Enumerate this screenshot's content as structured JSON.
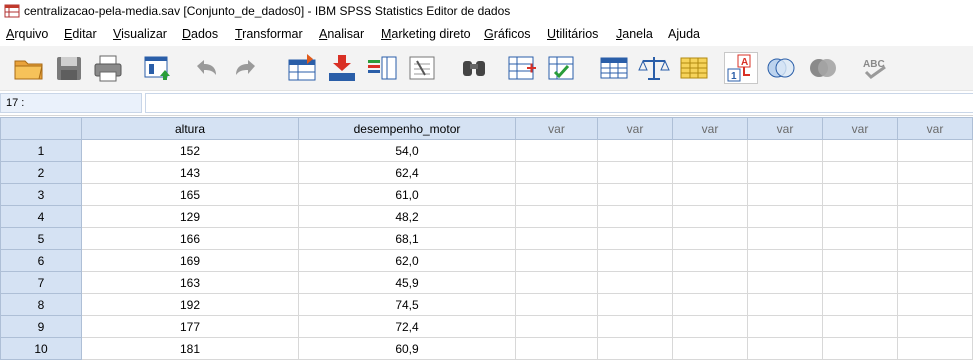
{
  "window": {
    "title": "centralizacao-pela-media.sav [Conjunto_de_dados0] - IBM SPSS Statistics Editor de dados",
    "icon": "spss-data-editor-icon"
  },
  "menu": [
    {
      "label": "Arquivo",
      "accel": "A"
    },
    {
      "label": "Editar",
      "accel": "E"
    },
    {
      "label": "Visualizar",
      "accel": "V"
    },
    {
      "label": "Dados",
      "accel": "D"
    },
    {
      "label": "Transformar",
      "accel": "T"
    },
    {
      "label": "Analisar",
      "accel": "A"
    },
    {
      "label": "Marketing direto",
      "accel": "M"
    },
    {
      "label": "Gráficos",
      "accel": "G"
    },
    {
      "label": "Utilitários",
      "accel": "U"
    },
    {
      "label": "Janela",
      "accel": "J"
    },
    {
      "label": "Ajuda",
      "accel": "u"
    }
  ],
  "toolbar": {
    "icons": [
      "open-folder-icon",
      "save-icon",
      "print-icon",
      "recall-dialog-icon",
      "undo-icon",
      "redo-icon",
      "go-to-case-icon",
      "go-to-variable-icon",
      "variables-icon",
      "run-descriptives-icon",
      "find-icon",
      "insert-cases-icon",
      "insert-variable-icon",
      "split-file-icon",
      "weight-cases-icon",
      "select-cases-icon",
      "value-labels-icon",
      "use-variable-sets-icon",
      "show-all-variables-icon",
      "spell-check-icon"
    ]
  },
  "cell_editor": {
    "reference": "17 :",
    "value": ""
  },
  "grid": {
    "columns": [
      "altura",
      "desempenho_motor",
      "var",
      "var",
      "var",
      "var",
      "var",
      "var"
    ],
    "rows": [
      {
        "n": "1",
        "altura": "152",
        "desempenho_motor": "54,0"
      },
      {
        "n": "2",
        "altura": "143",
        "desempenho_motor": "62,4"
      },
      {
        "n": "3",
        "altura": "165",
        "desempenho_motor": "61,0"
      },
      {
        "n": "4",
        "altura": "129",
        "desempenho_motor": "48,2"
      },
      {
        "n": "5",
        "altura": "166",
        "desempenho_motor": "68,1"
      },
      {
        "n": "6",
        "altura": "169",
        "desempenho_motor": "62,0"
      },
      {
        "n": "7",
        "altura": "163",
        "desempenho_motor": "45,9"
      },
      {
        "n": "8",
        "altura": "192",
        "desempenho_motor": "74,5"
      },
      {
        "n": "9",
        "altura": "177",
        "desempenho_motor": "72,4"
      },
      {
        "n": "10",
        "altura": "181",
        "desempenho_motor": "60,9"
      }
    ]
  },
  "colors": {
    "header_bg": "#d5e2f3",
    "empty_column_text": "#6b6b6b"
  }
}
